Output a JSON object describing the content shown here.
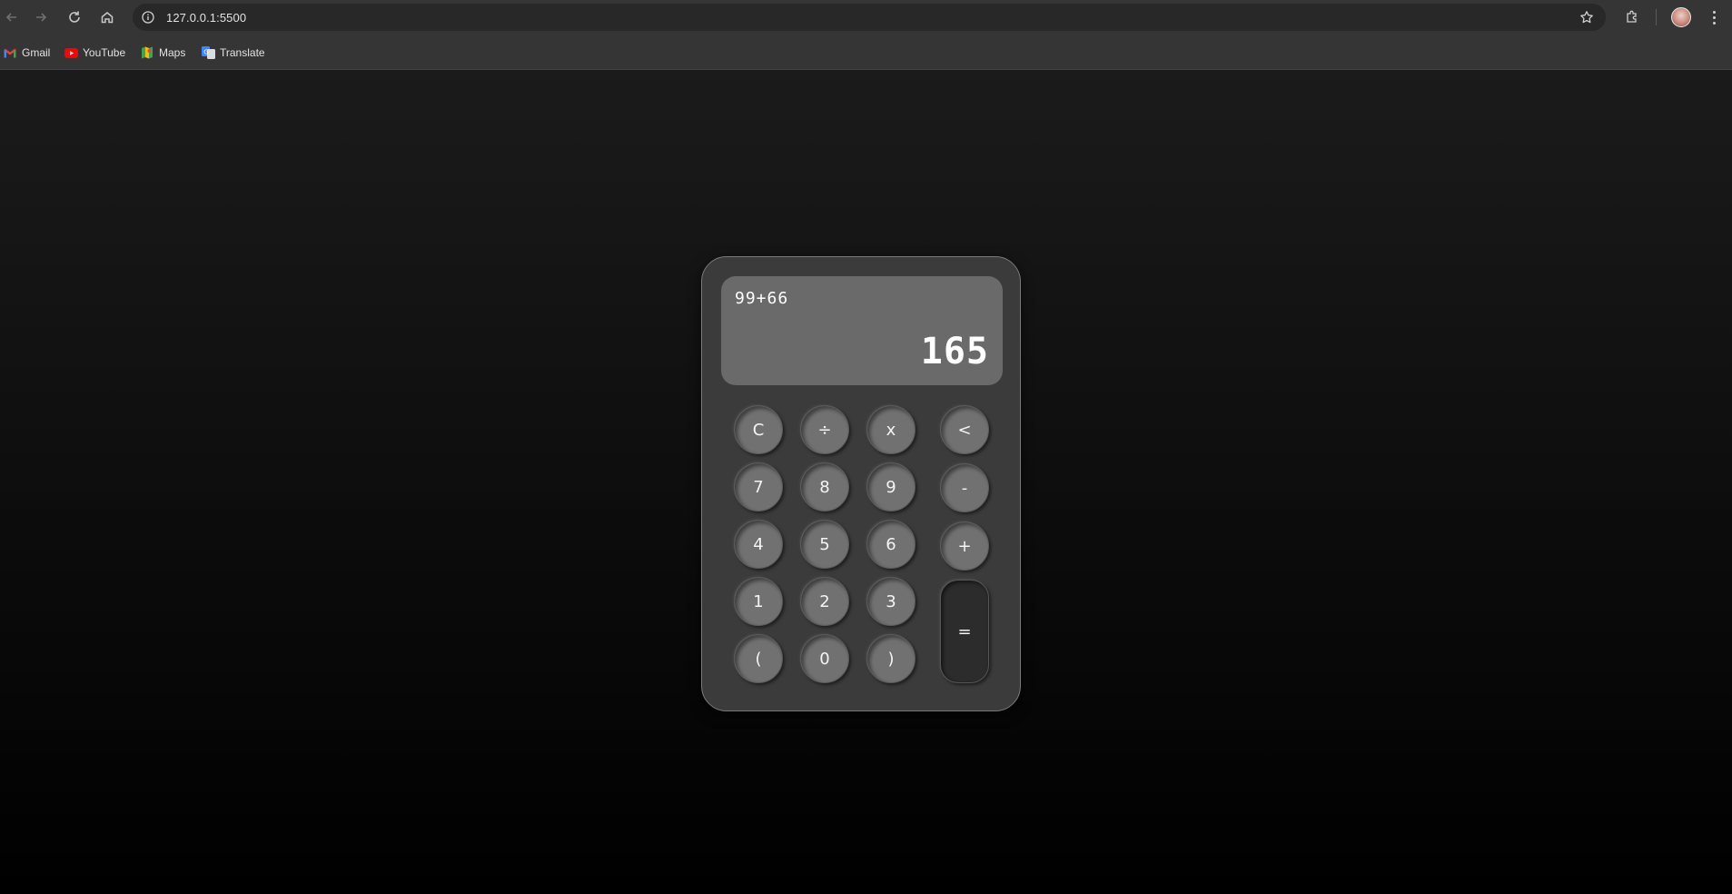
{
  "browser": {
    "url": "127.0.0.1:5500",
    "bookmarks": [
      {
        "label": "Gmail",
        "icon": "gmail-icon"
      },
      {
        "label": "YouTube",
        "icon": "youtube-icon"
      },
      {
        "label": "Maps",
        "icon": "maps-icon"
      },
      {
        "label": "Translate",
        "icon": "translate-icon"
      }
    ]
  },
  "calculator": {
    "expression": "99+66",
    "result": "165",
    "keys": {
      "clear": "C",
      "divide": "÷",
      "multiply": "x",
      "backspace": "<",
      "seven": "7",
      "eight": "8",
      "nine": "9",
      "minus": "-",
      "four": "4",
      "five": "5",
      "six": "6",
      "plus": "+",
      "one": "1",
      "two": "2",
      "three": "3",
      "equals": "=",
      "open_paren": "(",
      "zero": "0",
      "close_paren": ")"
    }
  },
  "colors": {
    "page_background": "#0a0a0a",
    "calculator_body": "#3b3b3b",
    "display_background": "#6a6a6a",
    "key_background": "#717171",
    "equals_background": "#2c2c2c"
  }
}
